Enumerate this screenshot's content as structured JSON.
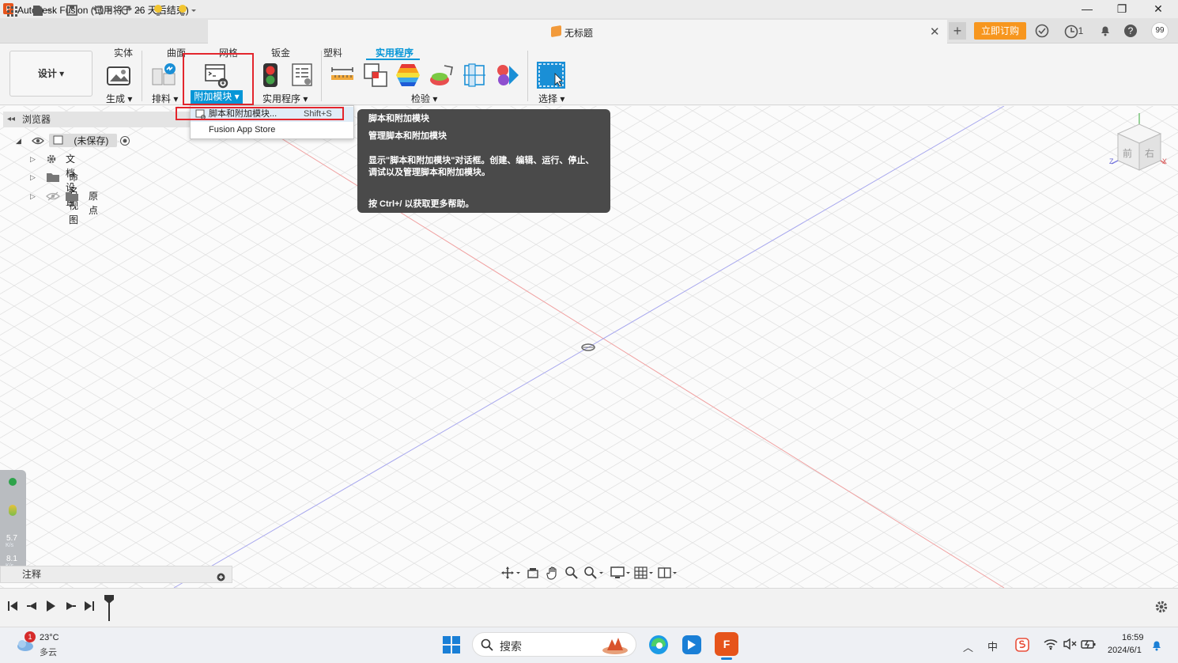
{
  "window": {
    "title": "Autodesk Fusion (试用将于 26 天后结束)",
    "app_icon_letter": "F",
    "minimize": "—",
    "maximize": "❐",
    "close": "✕"
  },
  "quick_access": {
    "doc_title": "无标题",
    "doc_close": "✕",
    "new_tab": "+",
    "buy_button": "立即订购",
    "jobs_count": "1",
    "avatar": "99"
  },
  "ribbon": {
    "tabs": [
      "实体",
      "曲面",
      "网格",
      "钣金",
      "塑料",
      "实用程序"
    ],
    "active_tab": "实用程序",
    "workspace": "设计 ▾",
    "groups": {
      "create": "生成 ▾",
      "arrange": "排料 ▾",
      "addins": "附加模块 ▾",
      "utility": "实用程序 ▾",
      "inspect": "检验 ▾",
      "select": "选择 ▾"
    }
  },
  "dropdown": {
    "items": [
      {
        "label": "脚本和附加模块...",
        "shortcut": "Shift+S"
      },
      {
        "label": "Fusion App Store",
        "shortcut": ""
      }
    ]
  },
  "tooltip": {
    "title": "脚本和附加模块",
    "subtitle": "管理脚本和附加模块",
    "description": "显示\"脚本和附加模块\"对话框。创建、编辑、运行、停止、调试以及管理脚本和附加模块。",
    "help": "按 Ctrl+/ 以获取更多帮助。"
  },
  "browser": {
    "title": "浏览器",
    "root": "(未保存)",
    "items": [
      "文档设置",
      "命名视图",
      "原点"
    ]
  },
  "comments": {
    "title": "注释"
  },
  "side_widget": {
    "upload": "5.7",
    "download": "8.1",
    "unit": "K/s"
  },
  "viewcube": {
    "front": "前",
    "right": "右",
    "x": "X",
    "z": "Z"
  },
  "taskbar": {
    "weather_temp": "23°C",
    "weather_desc": "多云",
    "weather_badge": "1",
    "search_placeholder": "搜索",
    "ime": "中",
    "time": "16:59",
    "date": "2024/6/1"
  },
  "colors": {
    "accent_blue": "#0696d7",
    "buy_orange": "#f7961e",
    "highlight_red": "#e3262d",
    "axis_red": "#f0a0a0",
    "axis_blue": "#a8a8ee"
  }
}
